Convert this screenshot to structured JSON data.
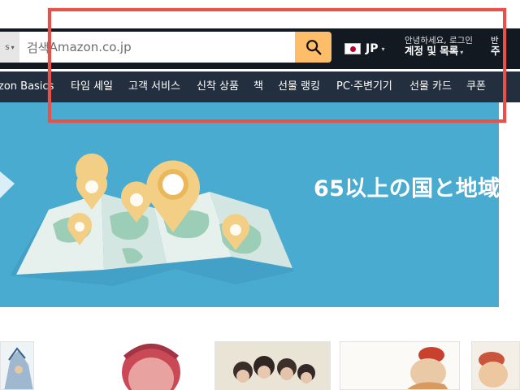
{
  "header": {
    "category_select_caret": "▾",
    "search": {
      "prefix": "검색",
      "placeholder": "Amazon.co.jp"
    },
    "language": {
      "code": "JP",
      "flag_icon": "japan-flag-icon"
    },
    "account": {
      "greeting": "안녕하세요, 로그인",
      "label": "계정 및 목록"
    },
    "returns": {
      "line1": "반",
      "line2": "주"
    }
  },
  "nav": {
    "items": [
      "zon Basics",
      "타임 세일",
      "고객 서비스",
      "신착 상품",
      "책",
      "선물 랭킹",
      "PC·주변기기",
      "선물 카드",
      "쿠폰"
    ]
  },
  "banner": {
    "headline": "65以上の国と地域"
  },
  "colors": {
    "header_bg": "#131921",
    "nav_bg": "#232f3e",
    "search_button": "#febd69",
    "banner_bg": "#4aabd1",
    "highlight": "#e8514a"
  }
}
